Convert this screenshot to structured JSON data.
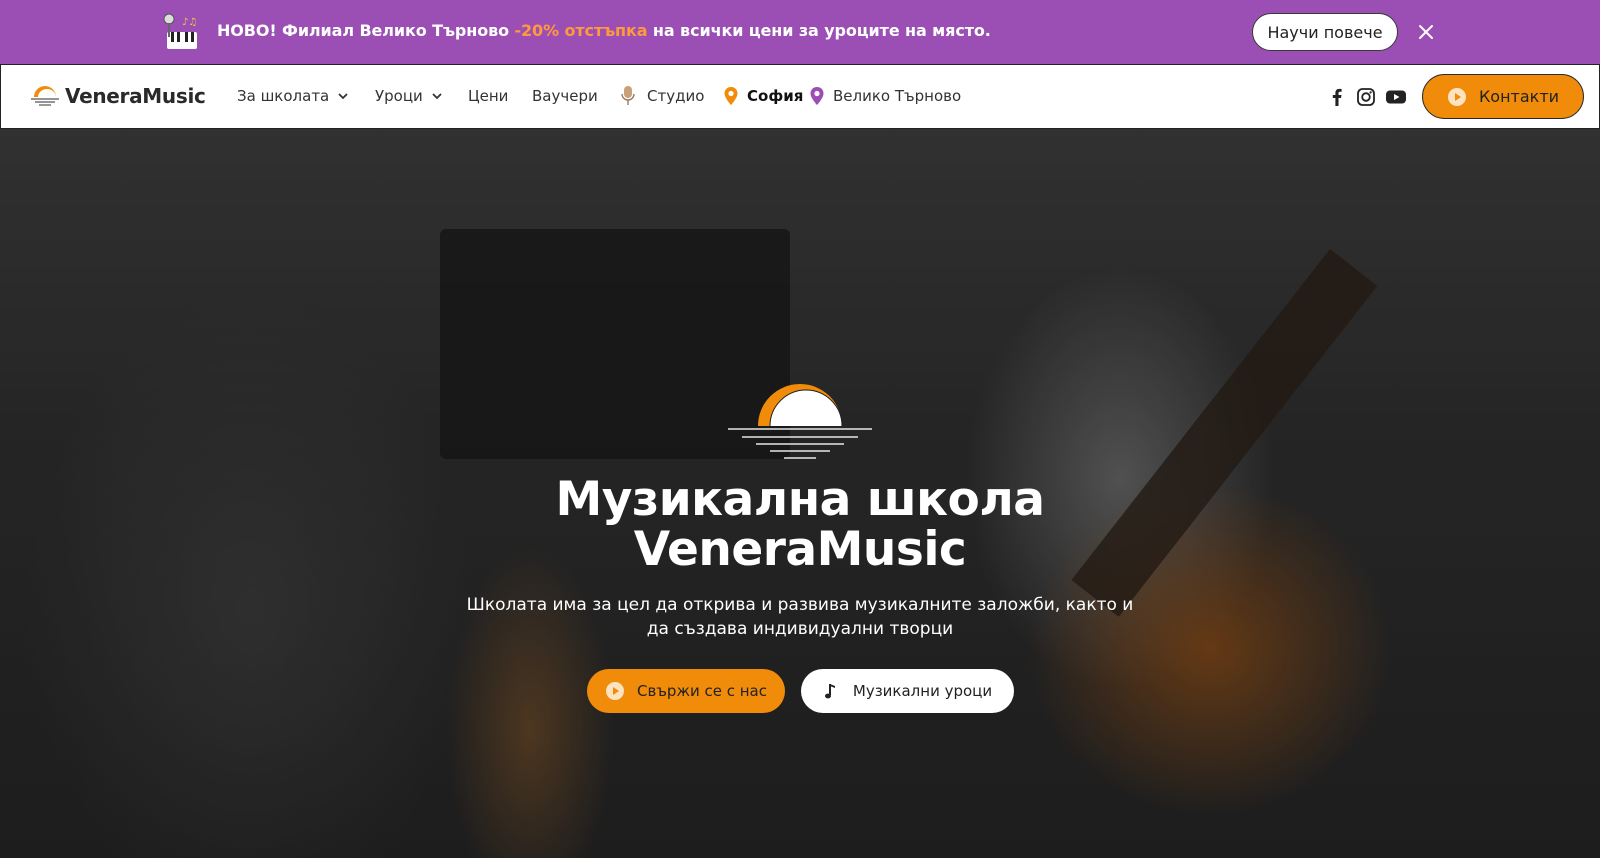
{
  "announcement": {
    "prefix": "НОВО! Филиал Велико Търново ",
    "highlight": "-20% отстъпка",
    "suffix": " на всички цени за уроците на място.",
    "button_label": "Научи повече",
    "highlight_color": "#ff9a3c",
    "background_color": "#9b4fb5"
  },
  "header": {
    "logo_text": "VeneraMusic",
    "nav": [
      {
        "label": "За школата",
        "has_dropdown": true
      },
      {
        "label": "Уроци",
        "has_dropdown": true
      },
      {
        "label": "Цени"
      },
      {
        "label": "Ваучери"
      },
      {
        "label": "Студио",
        "icon": "microphone-icon"
      },
      {
        "label": "София",
        "icon": "map-pin-icon",
        "active": true
      },
      {
        "label": "Велико Търново",
        "icon": "map-pin-icon"
      }
    ],
    "social": [
      "facebook-icon",
      "instagram-icon",
      "youtube-icon"
    ],
    "contact_label": "Контакти",
    "accent_color": "#f08c0a"
  },
  "hero": {
    "title_line1": "Музикална школа",
    "title_line2": "VeneraMusic",
    "subtitle_line1": "Школата има за цел да открива и развива музикалните заложби, както и",
    "subtitle_line2": "да създава индивидуални творци",
    "primary_button": "Свържи се с нас",
    "secondary_button": "Музикални уроци"
  }
}
